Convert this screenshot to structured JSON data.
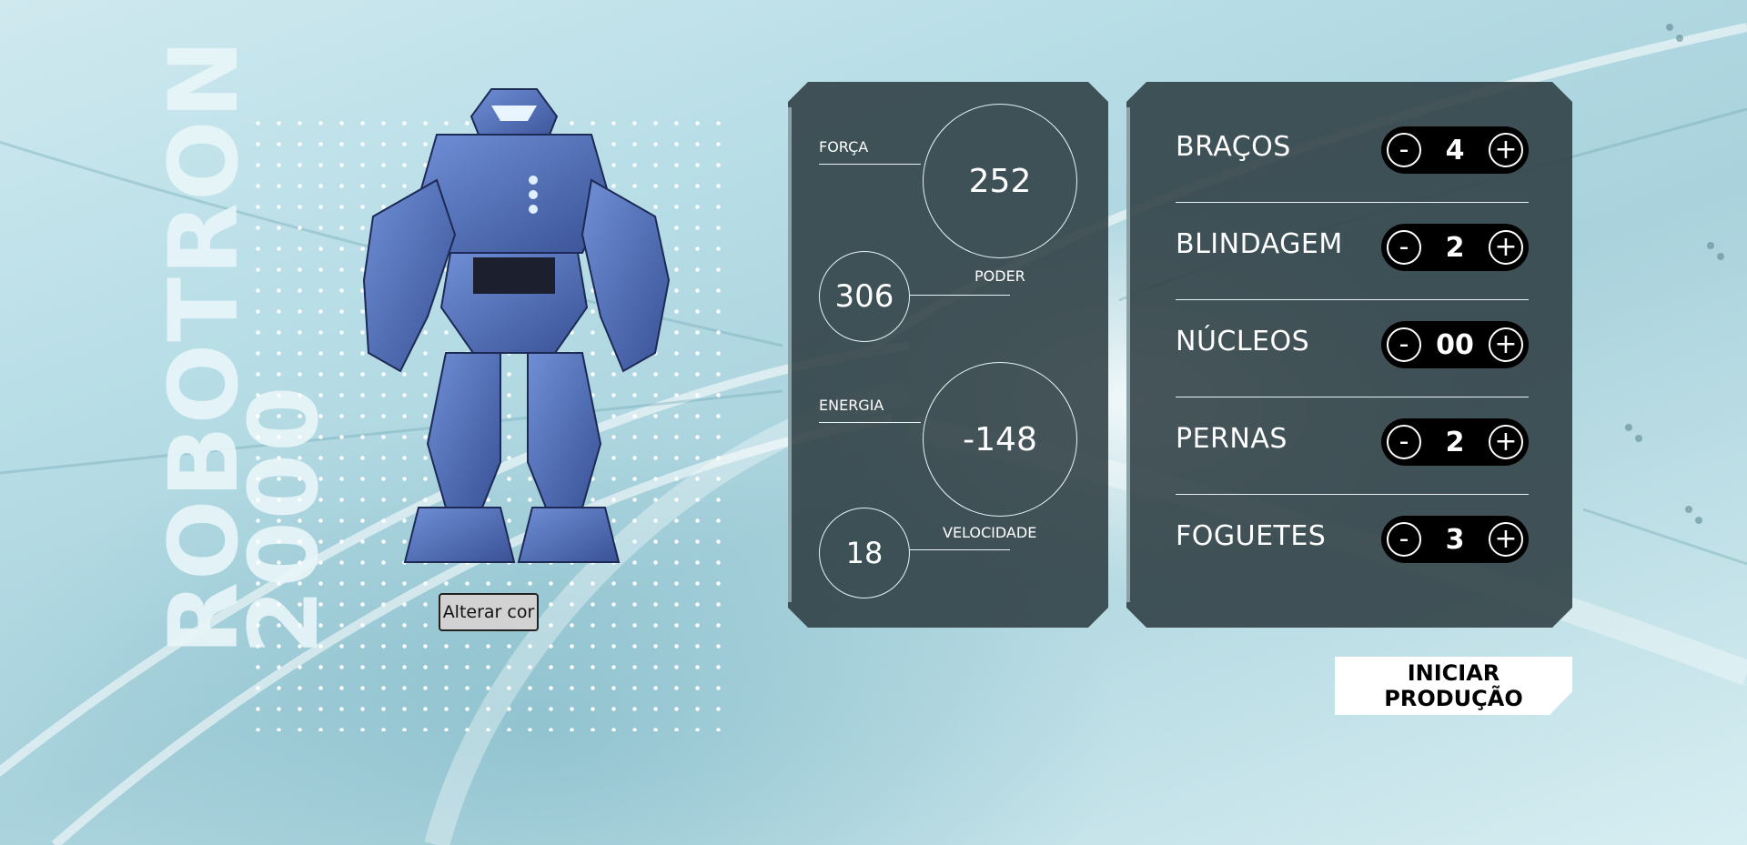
{
  "title": {
    "line1": "ROBOTRON",
    "line2": "2000"
  },
  "robot": {
    "alter_color_label": "Alterar cor"
  },
  "stats": {
    "forca": {
      "label": "FORÇA",
      "value": "252"
    },
    "poder": {
      "label": "PODER",
      "value": "306"
    },
    "energia": {
      "label": "ENERGIA",
      "value": "-148"
    },
    "velocidade": {
      "label": "VELOCIDADE",
      "value": "18"
    }
  },
  "parts": [
    {
      "name": "BRAÇOS",
      "value": "4",
      "minus": "-",
      "plus": "+"
    },
    {
      "name": "BLINDAGEM",
      "value": "2",
      "minus": "-",
      "plus": "+"
    },
    {
      "name": "NÚCLEOS",
      "value": "00",
      "minus": "-",
      "plus": "+"
    },
    {
      "name": "PERNAS",
      "value": "2",
      "minus": "-",
      "plus": "+"
    },
    {
      "name": "FOGUETES",
      "value": "3",
      "minus": "-",
      "plus": "+"
    }
  ],
  "start_button": {
    "label": "INICIAR PRODUÇÃO"
  },
  "colors": {
    "panel": "#2d3e42",
    "accent": "#ffffff",
    "background": "#b7dde6"
  }
}
